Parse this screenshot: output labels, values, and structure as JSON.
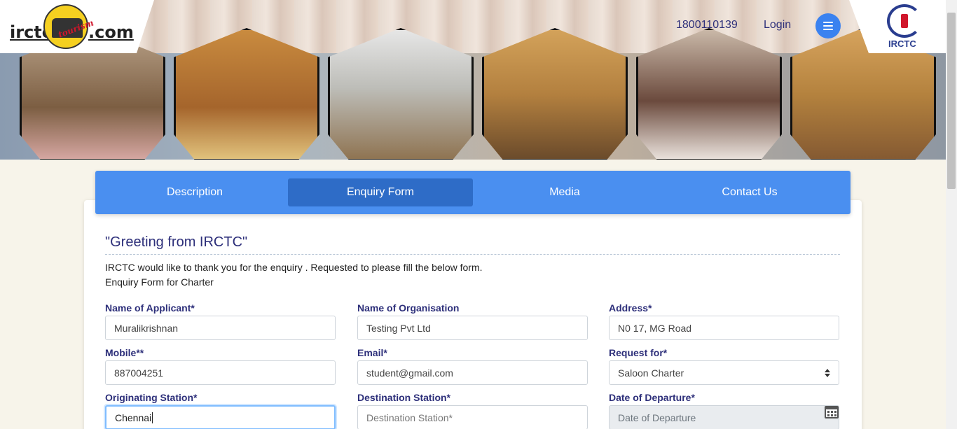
{
  "header": {
    "logo": {
      "left": "irctc",
      "tagline": "tourism",
      "right": ".com"
    },
    "phone": "1800110139",
    "login": "Login",
    "brand_label": "IRCTC"
  },
  "tabs": [
    {
      "label": "Description"
    },
    {
      "label": "Enquiry Form",
      "active": true
    },
    {
      "label": "Media"
    },
    {
      "label": "Contact Us"
    }
  ],
  "content": {
    "greeting": "\"Greeting from IRCTC\"",
    "intro_line1": "IRCTC would like to thank you for the enquiry . Requested to please fill the below form.",
    "intro_line2": "Enquiry Form for Charter"
  },
  "form": {
    "applicant": {
      "label": "Name of Applicant*",
      "value": "Muralikrishnan"
    },
    "organisation": {
      "label": "Name of Organisation",
      "value": "Testing Pvt Ltd"
    },
    "address": {
      "label": "Address*",
      "value": "N0 17, MG Road"
    },
    "mobile": {
      "label": "Mobile**",
      "value": "887004251"
    },
    "email": {
      "label": "Email*",
      "value": "student@gmail.com"
    },
    "request_for": {
      "label": "Request for*",
      "value": "Saloon Charter"
    },
    "origin": {
      "label": "Originating Station*",
      "value": "Chennai"
    },
    "destination": {
      "label": "Destination Station*",
      "placeholder": "Destination Station*"
    },
    "departure": {
      "label": "Date of Departure*",
      "placeholder": "Date of Departure"
    }
  },
  "colors": {
    "accent": "#4a8ff0",
    "active_tab": "#2e6cc7",
    "label": "#2d2f7a"
  }
}
